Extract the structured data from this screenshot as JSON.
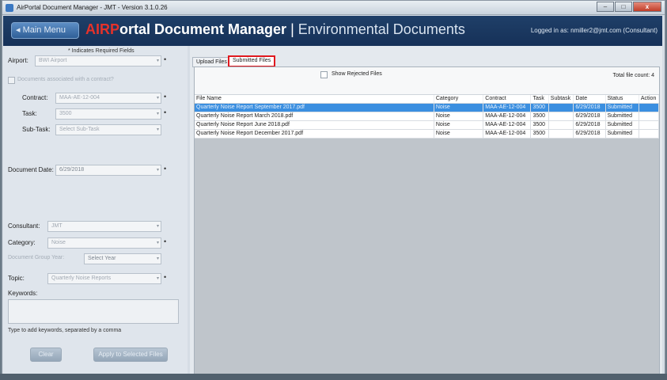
{
  "window": {
    "title": "AirPortal Document Manager - JMT - Version 3.1.0.26",
    "min": "–",
    "max": "□",
    "close": "x"
  },
  "header": {
    "main_menu": "◂ Main Menu",
    "title_air": "AIRP",
    "title_rest": "ortal Document Manager",
    "title_sep": " | ",
    "title_section": "Environmental Documents",
    "logged_in": "Logged in as: nmiller2@jmt.com (Consultant)"
  },
  "form": {
    "required_note": "* Indicates Required Fields",
    "airport_label": "Airport:",
    "airport_value": "BWI Airport",
    "contract_check_label": "Documents associated with a contract?",
    "contract_label": "Contract:",
    "contract_value": "MAA-AE-12-004",
    "task_label": "Task:",
    "task_value": "3500",
    "subtask_label": "Sub-Task:",
    "subtask_value": "Select Sub-Task",
    "docdate_label": "Document Date:",
    "docdate_value": "6/29/2018",
    "consultant_label": "Consultant:",
    "consultant_value": "JMT",
    "category_label": "Category:",
    "category_value": "Noise",
    "groupyear_label": "Document Group Year:",
    "groupyear_value": "Select Year",
    "topic_label": "Topic:",
    "topic_value": "Quarterly Noise Reports",
    "keywords_label": "Keywords:",
    "keywords_hint": "Type to add keywords, separated by a comma",
    "clear_button": "Clear",
    "apply_button": "Apply to Selected Files",
    "req_mark": "•",
    "arrow": "▾"
  },
  "tabs": {
    "upload": "Upload Files",
    "submitted": "Submitted Files"
  },
  "list": {
    "show_rejected": "Show Rejected Files",
    "total": "Total file count: 4",
    "columns": [
      "File Name",
      "Category",
      "Contract",
      "Task",
      "Subtask",
      "Date",
      "Status",
      "Action"
    ],
    "rows": [
      [
        "Quarterly Noise Report September 2017.pdf",
        "Noise",
        "MAA-AE-12-004",
        "3500",
        "",
        "6/29/2018",
        "Submitted",
        ""
      ],
      [
        "Quarterly Noise Report March 2018.pdf",
        "Noise",
        "MAA-AE-12-004",
        "3500",
        "",
        "6/29/2018",
        "Submitted",
        ""
      ],
      [
        "Quarterly Noise Report June 2018.pdf",
        "Noise",
        "MAA-AE-12-004",
        "3500",
        "",
        "6/29/2018",
        "Submitted",
        ""
      ],
      [
        "Quarterly Noise Report December 2017.pdf",
        "Noise",
        "MAA-AE-12-004",
        "3500",
        "",
        "6/29/2018",
        "Submitted",
        ""
      ]
    ]
  },
  "colors": {
    "accent_red": "#e0191f",
    "header_blue": "#1f3f68",
    "selected_row": "#3b8fe0"
  }
}
